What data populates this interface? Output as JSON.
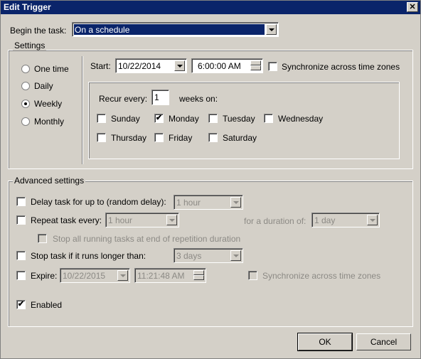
{
  "window": {
    "title": "Edit Trigger",
    "close_icon": "close-icon"
  },
  "begin": {
    "label": "Begin the task:",
    "value": "On a schedule"
  },
  "settings": {
    "legend": "Settings",
    "radios": [
      {
        "label": "One time",
        "checked": false
      },
      {
        "label": "Daily",
        "checked": false
      },
      {
        "label": "Weekly",
        "checked": true
      },
      {
        "label": "Monthly",
        "checked": false
      }
    ],
    "start_label": "Start:",
    "start_date": "10/22/2014",
    "start_time": "6:00:00 AM",
    "sync_label": "Synchronize across time zones",
    "sync_checked": false,
    "recur_label": "Recur every:",
    "recur_value": "1",
    "weeks_on_label": "weeks on:",
    "days": [
      {
        "label": "Sunday",
        "checked": false
      },
      {
        "label": "Monday",
        "checked": true
      },
      {
        "label": "Tuesday",
        "checked": false
      },
      {
        "label": "Wednesday",
        "checked": false
      },
      {
        "label": "Thursday",
        "checked": false
      },
      {
        "label": "Friday",
        "checked": false
      },
      {
        "label": "Saturday",
        "checked": false
      }
    ]
  },
  "advanced": {
    "legend": "Advanced settings",
    "delay_label": "Delay task for up to (random delay):",
    "delay_value": "1 hour",
    "repeat_label": "Repeat task every:",
    "repeat_value": "1 hour",
    "duration_label": "for a duration of:",
    "duration_value": "1 day",
    "stop_all_label": "Stop all running tasks at end of repetition duration",
    "stop_longer_label": "Stop task if it runs longer than:",
    "stop_longer_value": "3 days",
    "expire_label": "Expire:",
    "expire_date": "10/22/2015",
    "expire_time": "11:21:48 AM",
    "expire_sync_label": "Synchronize across time zones",
    "enabled_label": "Enabled",
    "enabled_checked": true
  },
  "buttons": {
    "ok": "OK",
    "cancel": "Cancel"
  },
  "colors": {
    "titlebar": "#0a246a",
    "face": "#d4d0c8",
    "disabled_text": "#8c8a85"
  }
}
